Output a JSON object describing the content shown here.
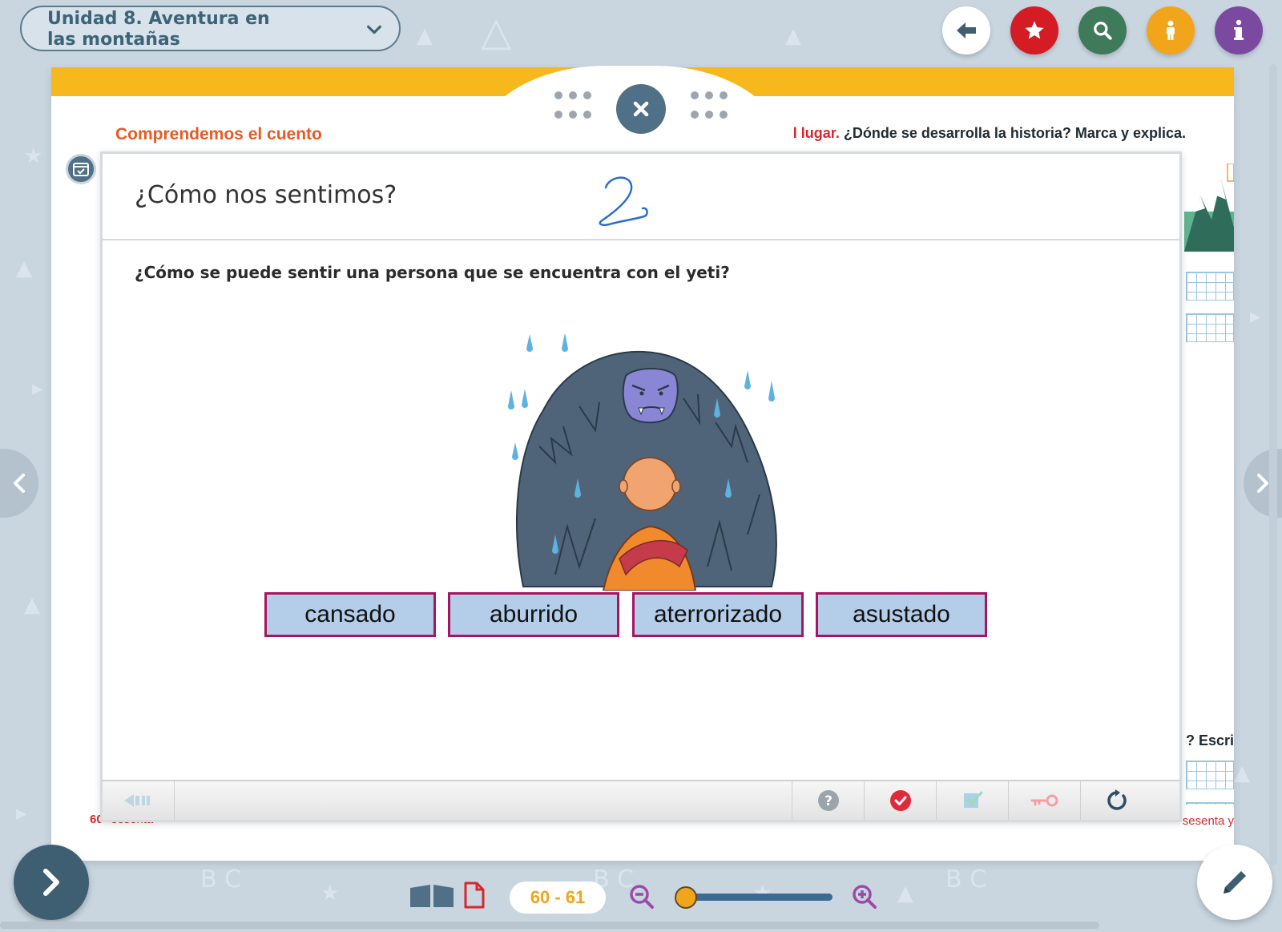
{
  "header": {
    "unit_title": "Unidad 8. Aventura en las montañas",
    "buttons": [
      {
        "name": "back",
        "color": "#ffffff",
        "icon": "arrow-left-icon"
      },
      {
        "name": "favorites",
        "color": "#d31c24",
        "icon": "star-icon"
      },
      {
        "name": "search",
        "color": "#3f7a5a",
        "icon": "search-icon"
      },
      {
        "name": "accessibility",
        "color": "#f0a51a",
        "icon": "person-icon"
      },
      {
        "name": "info",
        "color": "#7b4aa0",
        "icon": "info-icon"
      }
    ]
  },
  "book": {
    "section_heading": "Comprendemos el cuento",
    "right_text_red": "l lugar.",
    "right_text": " ¿Dónde se desarrolla la historia? Marca y explica.",
    "side_question": "? Escrib",
    "page_left_number": "60",
    "page_left_word": "sesenta",
    "page_right_word": "sesenta y"
  },
  "activity": {
    "title": "¿Cómo nos sentimos?",
    "handwritten_mark": "2",
    "question": "¿Cómo se puede sentir una persona que se encuentra con el yeti?",
    "options": [
      "cansado",
      "aburrido",
      "aterrorizado",
      "asustado"
    ],
    "option_colors": {
      "fill": "#b4cde8",
      "border": "#a8155f"
    },
    "toolbar": [
      "back-audio",
      "help",
      "check",
      "show-answers",
      "key",
      "reset"
    ]
  },
  "footer": {
    "page_range": "60 - 61",
    "accent": "#f0a51a"
  }
}
